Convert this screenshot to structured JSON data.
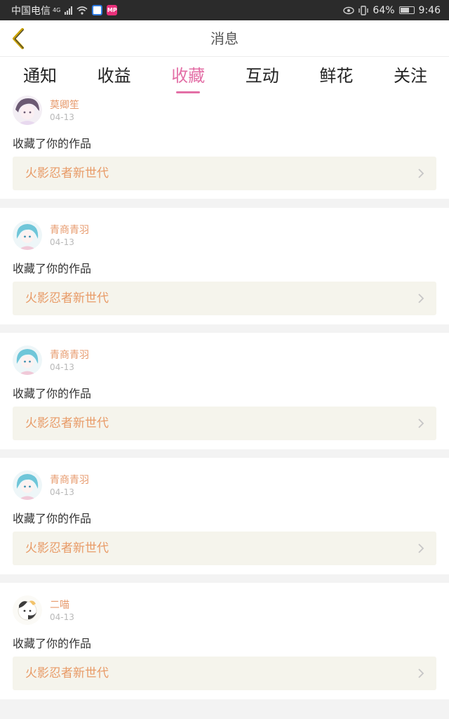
{
  "status_bar": {
    "carrier": "中国电信",
    "network": "4G",
    "battery": "64%",
    "time": "9:46"
  },
  "header": {
    "title": "消息"
  },
  "tabs": [
    {
      "label": "通知",
      "active": false
    },
    {
      "label": "收益",
      "active": false
    },
    {
      "label": "收藏",
      "active": true
    },
    {
      "label": "互动",
      "active": false
    },
    {
      "label": "鲜花",
      "active": false
    },
    {
      "label": "关注",
      "active": false
    }
  ],
  "notifications": [
    {
      "user": "莫卿笙",
      "date": "04-13",
      "action": "收藏了你的作品",
      "work": "火影忍者新世代"
    },
    {
      "user": "青商青羽",
      "date": "04-13",
      "action": "收藏了你的作品",
      "work": "火影忍者新世代"
    },
    {
      "user": "青商青羽",
      "date": "04-13",
      "action": "收藏了你的作品",
      "work": "火影忍者新世代"
    },
    {
      "user": "青商青羽",
      "date": "04-13",
      "action": "收藏了你的作品",
      "work": "火影忍者新世代"
    },
    {
      "user": "二喵",
      "date": "04-13",
      "action": "收藏了你的作品",
      "work": "火影忍者新世代"
    }
  ],
  "colors": {
    "accent": "#e36fa6",
    "username": "#e79a6d",
    "work_title": "#e89a66",
    "work_bg": "#f5f4ec"
  }
}
